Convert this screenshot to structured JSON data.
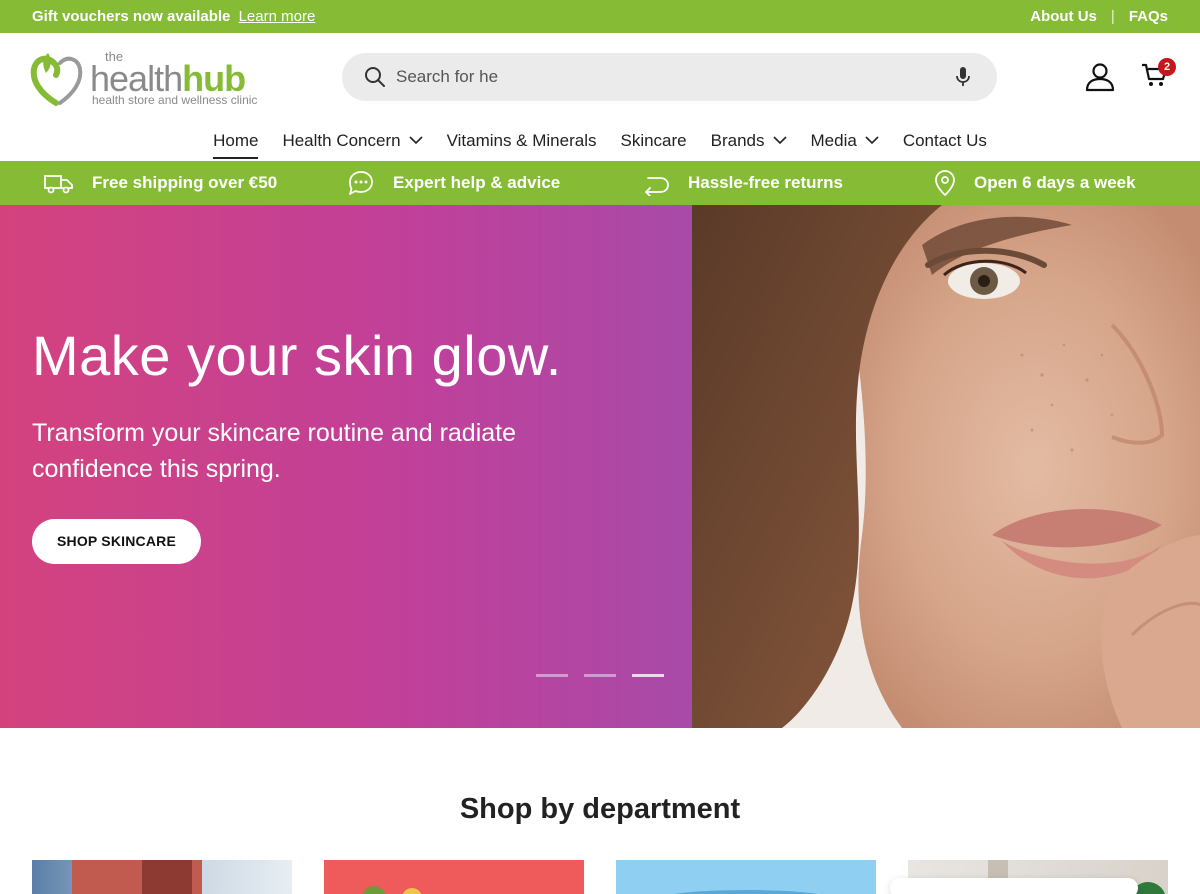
{
  "topbar": {
    "promo_text": "Gift vouchers now available",
    "promo_link": "Learn more",
    "about": "About Us",
    "separator": "|",
    "faqs": "FAQs"
  },
  "logo": {
    "the": "the",
    "health": "health",
    "hub": "hub",
    "tagline": "health store and wellness clinic"
  },
  "search": {
    "value": "Search for he"
  },
  "cart": {
    "count": "2"
  },
  "nav": [
    {
      "label": "Home",
      "active": true
    },
    {
      "label": "Health Concern",
      "dropdown": true
    },
    {
      "label": "Vitamins & Minerals"
    },
    {
      "label": "Skincare"
    },
    {
      "label": "Brands",
      "dropdown": true
    },
    {
      "label": "Media",
      "dropdown": true
    },
    {
      "label": "Contact Us"
    }
  ],
  "benefits": [
    {
      "icon": "truck-icon",
      "label": "Free shipping over €50"
    },
    {
      "icon": "chat-bubble-icon",
      "label": "Expert help & advice"
    },
    {
      "icon": "return-arrow-icon",
      "label": "Hassle-free returns"
    },
    {
      "icon": "map-pin-icon",
      "label": "Open 6 days a week"
    }
  ],
  "hero": {
    "title": "Make your skin glow.",
    "subtitle": "Transform your skincare routine and radiate confidence this spring.",
    "button": "SHOP SKINCARE",
    "slides": 3,
    "active_slide": 3
  },
  "department": {
    "title": "Shop by department"
  },
  "colors": {
    "brand_green": "#86bc35",
    "hero_pink": "#d4427e",
    "hero_purple": "#a84aa8",
    "badge_red": "#c4161c"
  }
}
